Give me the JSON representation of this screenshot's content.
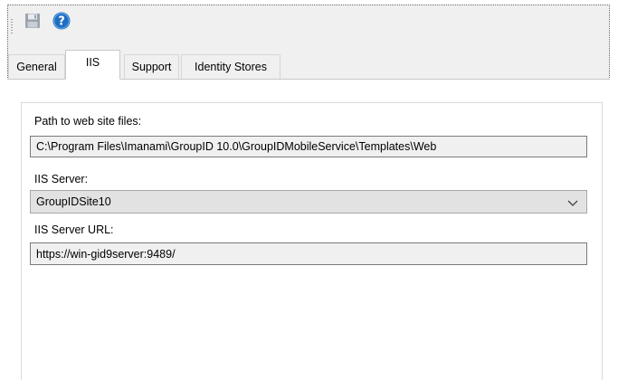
{
  "toolbar": {
    "save_icon": "save-icon",
    "help_icon": "help-icon",
    "help_glyph": "?",
    "help_color": "#1f6fc1"
  },
  "tabs": [
    {
      "label": "General",
      "active": false
    },
    {
      "label": "IIS",
      "active": true
    },
    {
      "label": "Support",
      "active": false
    },
    {
      "label": "Identity Stores",
      "active": false
    }
  ],
  "iis": {
    "path_label": "Path to web site files:",
    "path_value": "C:\\Program Files\\Imanami\\GroupID 10.0\\GroupIDMobileService\\Templates\\Web",
    "server_label": "IIS Server:",
    "server_selected": "GroupIDSite10",
    "url_label": "IIS Server URL:",
    "url_value": "https://win-gid9server:9489/"
  }
}
